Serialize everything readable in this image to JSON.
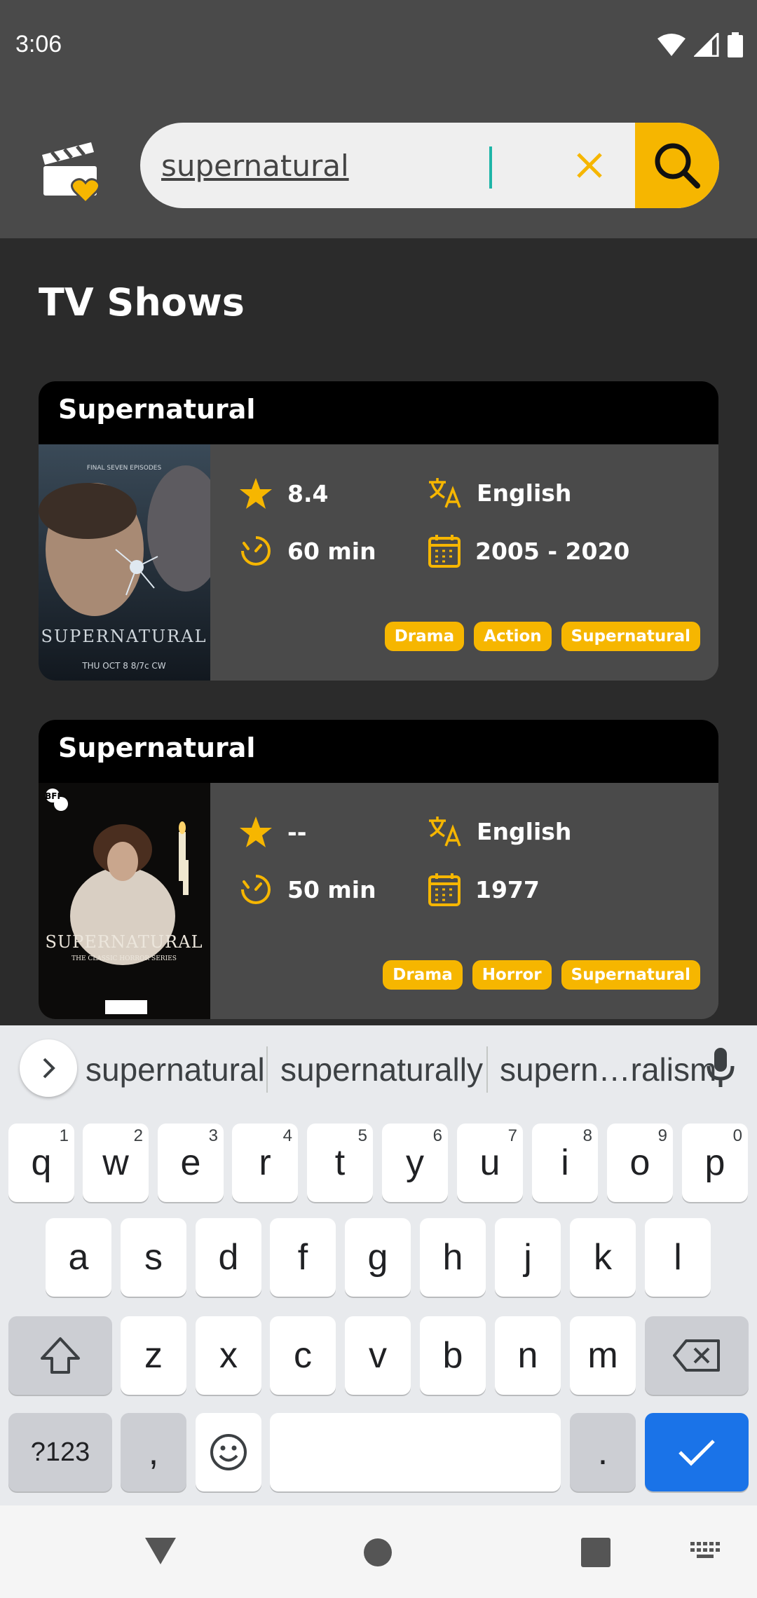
{
  "status_bar": {
    "time": "3:06"
  },
  "search": {
    "value": "supernatural",
    "placeholder": ""
  },
  "section": {
    "title": "TV Shows"
  },
  "shows": [
    {
      "title": "Supernatural",
      "rating": "8.4",
      "language": "English",
      "runtime": "60 min",
      "years": "2005 - 2020",
      "genres": [
        "Drama",
        "Action",
        "Supernatural"
      ],
      "poster": {
        "caption": "SUPERNATURAL",
        "top_text": "FINAL SEVEN EPISODES",
        "bottom_text": "THU OCT 8 8/7c CW"
      }
    },
    {
      "title": "Supernatural",
      "rating": "--",
      "language": "English",
      "runtime": "50 min",
      "years": "1977",
      "genres": [
        "Drama",
        "Horror",
        "Supernatural"
      ],
      "poster": {
        "caption": "SUPERNATURAL",
        "top_text": "BFI",
        "bottom_text": "THE CLASSIC HORROR SERIES"
      }
    }
  ],
  "keyboard": {
    "suggestions": [
      "supernatural",
      "supernaturally",
      "supern…ralism"
    ],
    "row1": [
      {
        "k": "q",
        "h": "1"
      },
      {
        "k": "w",
        "h": "2"
      },
      {
        "k": "e",
        "h": "3"
      },
      {
        "k": "r",
        "h": "4"
      },
      {
        "k": "t",
        "h": "5"
      },
      {
        "k": "y",
        "h": "6"
      },
      {
        "k": "u",
        "h": "7"
      },
      {
        "k": "i",
        "h": "8"
      },
      {
        "k": "o",
        "h": "9"
      },
      {
        "k": "p",
        "h": "0"
      }
    ],
    "row2": [
      "a",
      "s",
      "d",
      "f",
      "g",
      "h",
      "j",
      "k",
      "l"
    ],
    "row3": [
      "z",
      "x",
      "c",
      "v",
      "b",
      "n",
      "m"
    ],
    "symbols_label": "?123",
    "comma_label": ",",
    "period_label": "."
  },
  "colors": {
    "accent": "#f6b600",
    "header_bg": "#4a4a4a",
    "page_bg": "#2b2b2b",
    "keyboard_action": "#1a73e8"
  }
}
